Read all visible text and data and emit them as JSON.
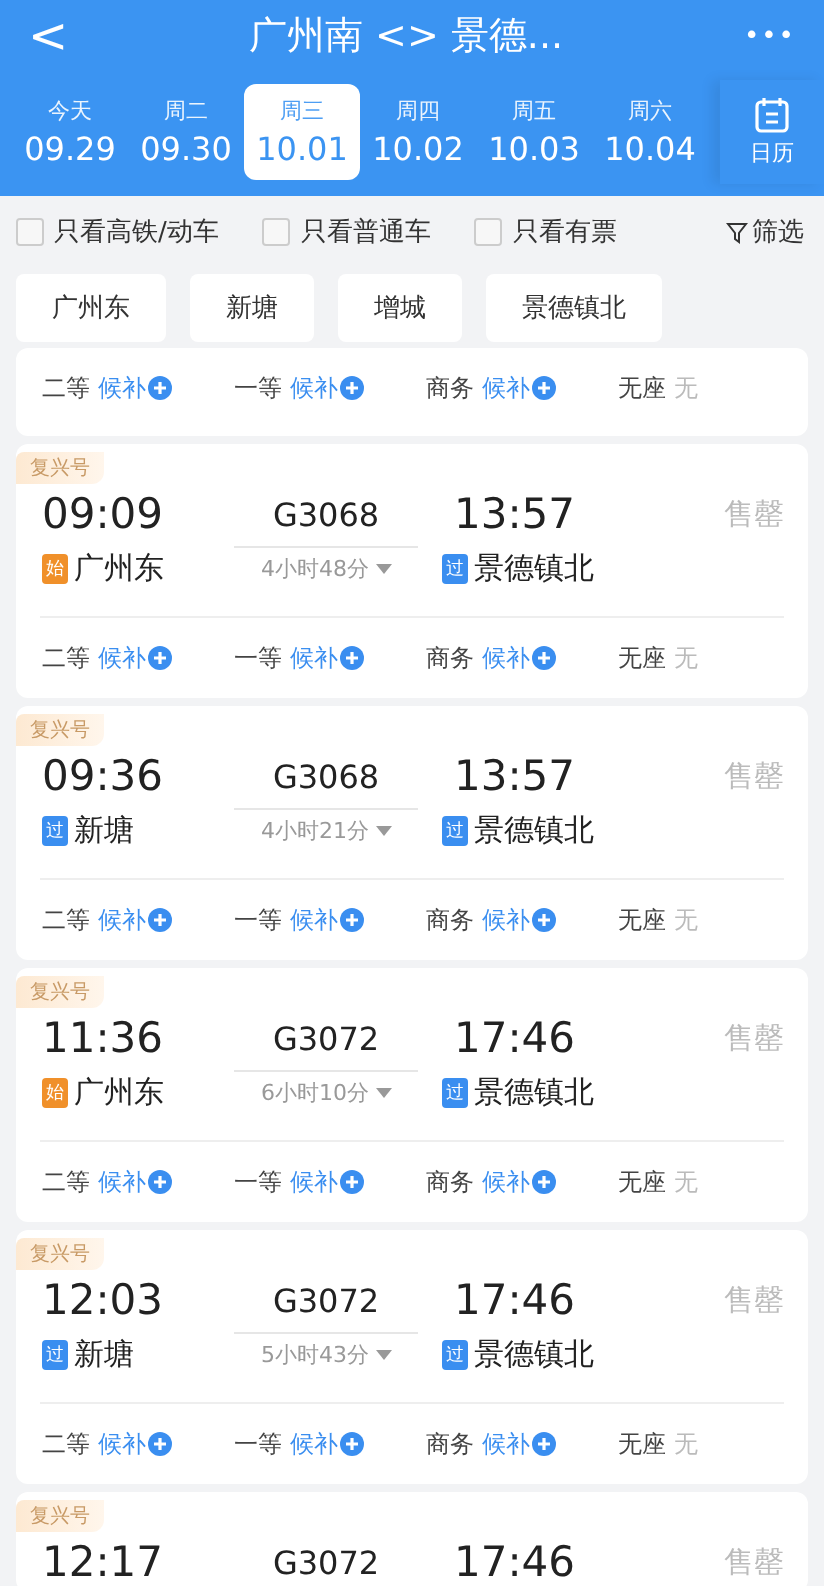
{
  "header": {
    "back": "<",
    "title": "广州南 <> 景德...",
    "more": "•••"
  },
  "dates": [
    {
      "weekday": "今天",
      "date": "09.29",
      "selected": false
    },
    {
      "weekday": "周二",
      "date": "09.30",
      "selected": false
    },
    {
      "weekday": "周三",
      "date": "10.01",
      "selected": true
    },
    {
      "weekday": "周四",
      "date": "10.02",
      "selected": false
    },
    {
      "weekday": "周五",
      "date": "10.03",
      "selected": false
    },
    {
      "weekday": "周六",
      "date": "10.04",
      "selected": false
    }
  ],
  "calendar": {
    "label": "日历"
  },
  "filters": [
    {
      "label": "只看高铁/动车",
      "checked": false
    },
    {
      "label": "只看普通车",
      "checked": false
    },
    {
      "label": "只看有票",
      "checked": false
    }
  ],
  "filter_button": "筛选",
  "stations": [
    "广州东",
    "新塘",
    "增城",
    "景德镇北"
  ],
  "partial_card": {
    "seats": [
      {
        "class": "二等",
        "status": "候补",
        "kind": "waitlist"
      },
      {
        "class": "一等",
        "status": "候补",
        "kind": "waitlist"
      },
      {
        "class": "商务",
        "status": "候补",
        "kind": "waitlist"
      },
      {
        "class": "无座",
        "status": "无",
        "kind": "none"
      }
    ]
  },
  "trains": [
    {
      "tag": "复兴号",
      "depart": "09:09",
      "number": "G3068",
      "arrive": "13:57",
      "availability": "售罄",
      "duration": "4小时48分",
      "stops": [
        {
          "badge": "始",
          "name": "广州东",
          "color": "#f0902a"
        },
        {
          "badge": "过",
          "name": "景德镇北",
          "color": "#3a8ef0"
        }
      ],
      "seats": [
        {
          "class": "二等",
          "status": "候补",
          "kind": "waitlist"
        },
        {
          "class": "一等",
          "status": "候补",
          "kind": "waitlist"
        },
        {
          "class": "商务",
          "status": "候补",
          "kind": "waitlist"
        },
        {
          "class": "无座",
          "status": "无",
          "kind": "none"
        }
      ]
    },
    {
      "tag": "复兴号",
      "depart": "09:36",
      "number": "G3068",
      "arrive": "13:57",
      "availability": "售罄",
      "duration": "4小时21分",
      "stops": [
        {
          "badge": "过",
          "name": "新塘",
          "color": "#3a8ef0"
        },
        {
          "badge": "过",
          "name": "景德镇北",
          "color": "#3a8ef0"
        }
      ],
      "seats": [
        {
          "class": "二等",
          "status": "候补",
          "kind": "waitlist"
        },
        {
          "class": "一等",
          "status": "候补",
          "kind": "waitlist"
        },
        {
          "class": "商务",
          "status": "候补",
          "kind": "waitlist"
        },
        {
          "class": "无座",
          "status": "无",
          "kind": "none"
        }
      ]
    },
    {
      "tag": "复兴号",
      "depart": "11:36",
      "number": "G3072",
      "arrive": "17:46",
      "availability": "售罄",
      "duration": "6小时10分",
      "stops": [
        {
          "badge": "始",
          "name": "广州东",
          "color": "#f0902a"
        },
        {
          "badge": "过",
          "name": "景德镇北",
          "color": "#3a8ef0"
        }
      ],
      "seats": [
        {
          "class": "二等",
          "status": "候补",
          "kind": "waitlist"
        },
        {
          "class": "一等",
          "status": "候补",
          "kind": "waitlist"
        },
        {
          "class": "商务",
          "status": "候补",
          "kind": "waitlist"
        },
        {
          "class": "无座",
          "status": "无",
          "kind": "none"
        }
      ]
    },
    {
      "tag": "复兴号",
      "depart": "12:03",
      "number": "G3072",
      "arrive": "17:46",
      "availability": "售罄",
      "duration": "5小时43分",
      "stops": [
        {
          "badge": "过",
          "name": "新塘",
          "color": "#3a8ef0"
        },
        {
          "badge": "过",
          "name": "景德镇北",
          "color": "#3a8ef0"
        }
      ],
      "seats": [
        {
          "class": "二等",
          "status": "候补",
          "kind": "waitlist"
        },
        {
          "class": "一等",
          "status": "候补",
          "kind": "waitlist"
        },
        {
          "class": "商务",
          "status": "候补",
          "kind": "waitlist"
        },
        {
          "class": "无座",
          "status": "无",
          "kind": "none"
        }
      ]
    },
    {
      "tag": "复兴号",
      "depart": "12:17",
      "number": "G3072",
      "arrive": "17:46",
      "availability": "售罄"
    }
  ]
}
